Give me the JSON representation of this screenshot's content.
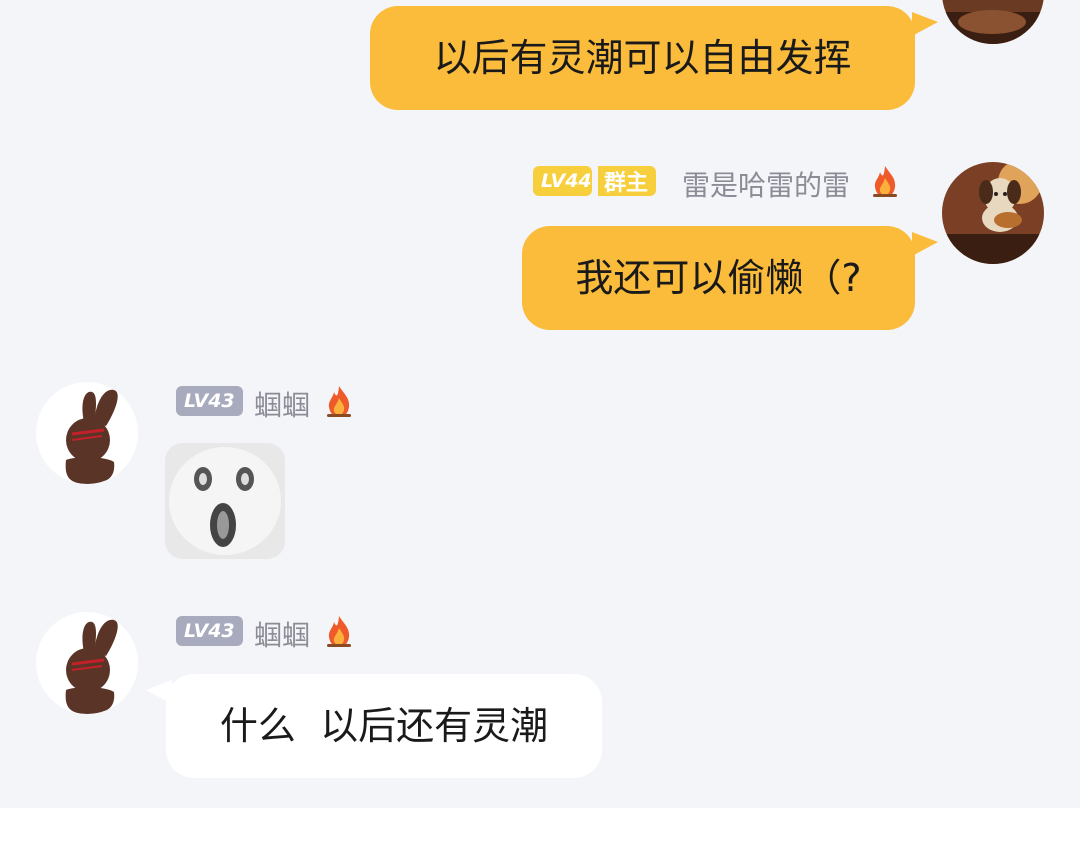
{
  "colors": {
    "background": "#f4f5f9",
    "outgoing_bubble": "#fbbc3c",
    "incoming_bubble": "#ffffff",
    "level_badge_owner": "#f7cf3c",
    "level_badge_member": "#a7abbd",
    "owner_role_badge": "#f7cf3c"
  },
  "messages": [
    {
      "direction": "outgoing",
      "text": "以后有灵潮可以自由发挥"
    },
    {
      "direction": "outgoing",
      "sender": {
        "level": "LV44",
        "role": "群主",
        "name": "雷是哈雷的雷",
        "icon": "fire-icon"
      },
      "text": "我还可以偷懒（?"
    },
    {
      "direction": "incoming",
      "sender": {
        "level": "LV43",
        "name": "蝈蝈",
        "icon": "fire-icon"
      },
      "type": "sticker",
      "sticker": "surprised-face-sticker"
    },
    {
      "direction": "incoming",
      "sender": {
        "level": "LV43",
        "name": "蝈蝈",
        "icon": "fire-icon"
      },
      "text": "什么  以后还有灵潮"
    }
  ]
}
